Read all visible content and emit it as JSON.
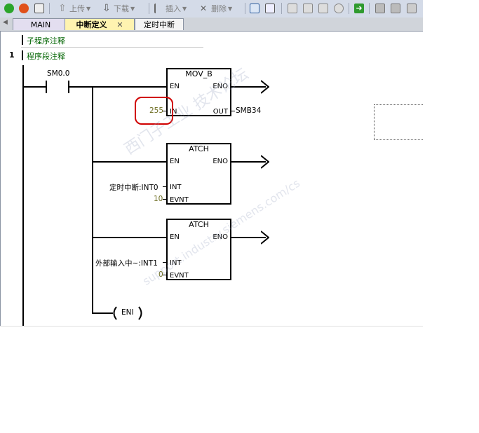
{
  "toolbar": {
    "up_label": "上传",
    "down_label": "下载",
    "insert_label": "插入",
    "delete_label": "删除"
  },
  "tabs": [
    {
      "label": "MAIN"
    },
    {
      "label": "中断定义",
      "active": true
    },
    {
      "label": "定时中断"
    }
  ],
  "editor": {
    "subroutine_comment": "子程序注释",
    "network_number": "1",
    "network_comment": "程序段注释"
  },
  "ladder": {
    "contact_label": "SM0.0",
    "mov": {
      "title": "MOV_B",
      "en": "EN",
      "eno": "ENO",
      "in": "IN",
      "out": "OUT",
      "in_value": "255",
      "out_value": "SMB34"
    },
    "atch1": {
      "title": "ATCH",
      "en": "EN",
      "eno": "ENO",
      "int": "INT",
      "evnt": "EVNT",
      "int_value": "定时中断:INT0",
      "evnt_value": "10"
    },
    "atch2": {
      "title": "ATCH",
      "en": "EN",
      "eno": "ENO",
      "int": "INT",
      "evnt": "EVNT",
      "int_value": "外部输入中~:INT1",
      "evnt_value": "0"
    },
    "eni_coil": "ENI"
  },
  "watermark": {
    "line1": "西门子工业  技术论坛",
    "line2": "support.industry.siemens.com/cs"
  },
  "colors": {
    "highlight": "#d00000",
    "comment": "#006400",
    "constant": "#6b6b1f",
    "active_tab": "#fff3b0"
  }
}
